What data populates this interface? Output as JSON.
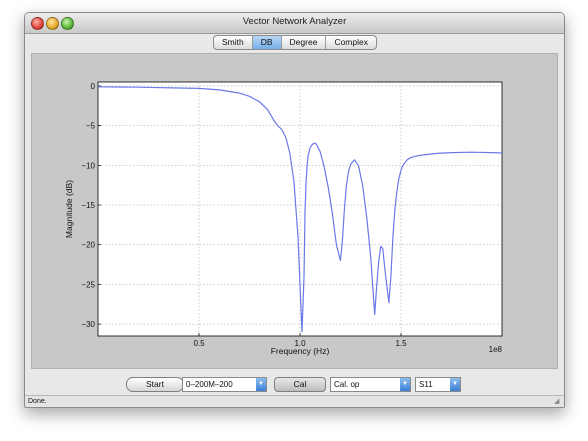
{
  "window": {
    "title": "Vector Network Analyzer"
  },
  "tabs": [
    {
      "label": "Smith",
      "active": false
    },
    {
      "label": "DB",
      "active": true
    },
    {
      "label": "Degree",
      "active": false
    },
    {
      "label": "Complex",
      "active": false
    }
  ],
  "chart_data": {
    "type": "line",
    "xlabel": "Frequency (Hz)",
    "ylabel": "Magnitude (dB)",
    "x_scale_label": "1e8",
    "xlim": [
      0.0,
      2.0
    ],
    "ylim": [
      -31.5,
      0.5
    ],
    "xticks": [
      0.5,
      1.0,
      1.5
    ],
    "xtick_labels": [
      "0.5",
      "1.0",
      "1.5"
    ],
    "yticks": [
      0,
      -5,
      -10,
      -15,
      -20,
      -25,
      -30
    ],
    "ytick_labels": [
      "0",
      "−5",
      "−10",
      "−15",
      "−20",
      "−25",
      "−30"
    ],
    "grid": true,
    "line_color": "#6a78e8",
    "series": [
      {
        "x": [
          0.0,
          0.2,
          0.4,
          0.5,
          0.6,
          0.7,
          0.75,
          0.8,
          0.84,
          0.87,
          0.89,
          0.91,
          0.93,
          0.95,
          0.97,
          0.99,
          1.0,
          1.01,
          1.02,
          1.025,
          1.03,
          1.035,
          1.04,
          1.05,
          1.06,
          1.07,
          1.08,
          1.1,
          1.12,
          1.14,
          1.16,
          1.18,
          1.2,
          1.21,
          1.22,
          1.23,
          1.24,
          1.25,
          1.27,
          1.29,
          1.31,
          1.33,
          1.35,
          1.37,
          1.38,
          1.39,
          1.4,
          1.41,
          1.42,
          1.44,
          1.45,
          1.46,
          1.47,
          1.48,
          1.49,
          1.5,
          1.51,
          1.53,
          1.55,
          1.58,
          1.62,
          1.68,
          1.75,
          1.85,
          1.95,
          2.0
        ],
        "y": [
          -0.1,
          -0.15,
          -0.25,
          -0.3,
          -0.5,
          -0.9,
          -1.3,
          -2.0,
          -3.0,
          -4.3,
          -5.0,
          -5.5,
          -6.5,
          -8.5,
          -12.0,
          -19.0,
          -25.0,
          -31.0,
          -24.0,
          -16.0,
          -12.0,
          -10.0,
          -8.8,
          -7.8,
          -7.4,
          -7.2,
          -7.3,
          -8.3,
          -10.2,
          -12.8,
          -16.0,
          -20.0,
          -22.0,
          -19.5,
          -15.5,
          -12.5,
          -10.8,
          -9.9,
          -9.3,
          -10.1,
          -12.5,
          -16.5,
          -21.5,
          -28.8,
          -25.0,
          -22.0,
          -20.2,
          -20.5,
          -23.0,
          -27.3,
          -24.0,
          -19.0,
          -15.5,
          -13.2,
          -11.6,
          -10.6,
          -10.0,
          -9.3,
          -9.0,
          -8.8,
          -8.65,
          -8.5,
          -8.4,
          -8.35,
          -8.4,
          -8.45
        ]
      }
    ]
  },
  "controls": {
    "start_label": "Start",
    "range_value": "0–200M–200",
    "cal_label": "Cal",
    "cal_option_value": "Cal. op",
    "param_value": "S11"
  },
  "status": {
    "text": "Done."
  },
  "icons": {
    "dropdown": "chevron-down-icon",
    "resize": "resize-grip-icon"
  }
}
